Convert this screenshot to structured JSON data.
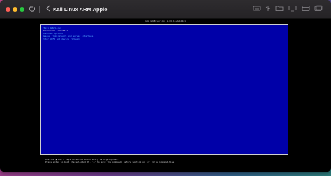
{
  "window": {
    "title": "Kali Linux ARM Apple"
  },
  "grub": {
    "header": "GNU GRUB  version 2.06-13+deb12u1",
    "menu_items": [
      {
        "label": "*Kali GNU/Linux",
        "selected": false
      },
      {
        "label": "Bootloader installer",
        "selected": true
      },
      {
        "label": "Advanced options",
        "selected": false
      },
      {
        "label": "Rescue from network and server interface",
        "selected": false
      },
      {
        "label": "Enter UEFI and device firmware",
        "selected": false
      }
    ],
    "help_lines": [
      "Use the ▲ and ▼ keys to select which entry is highlighted.",
      "Press enter to boot the selected OS, `e' to edit the commands before booting or `c' for a command-line."
    ]
  },
  "colors": {
    "menu_background": "#0000a8",
    "menu_text": "#55aaff",
    "selected_text": "#ffffff",
    "close": "#ff5f57",
    "minimize": "#febc2e",
    "maximize": "#28c840"
  },
  "icons": {
    "power": "power-icon",
    "back": "chevron-left-icon",
    "toolbar": [
      "keyboard-icon",
      "usb-icon",
      "folder-icon",
      "display-icon",
      "share-icon",
      "snapshot-icon"
    ]
  }
}
